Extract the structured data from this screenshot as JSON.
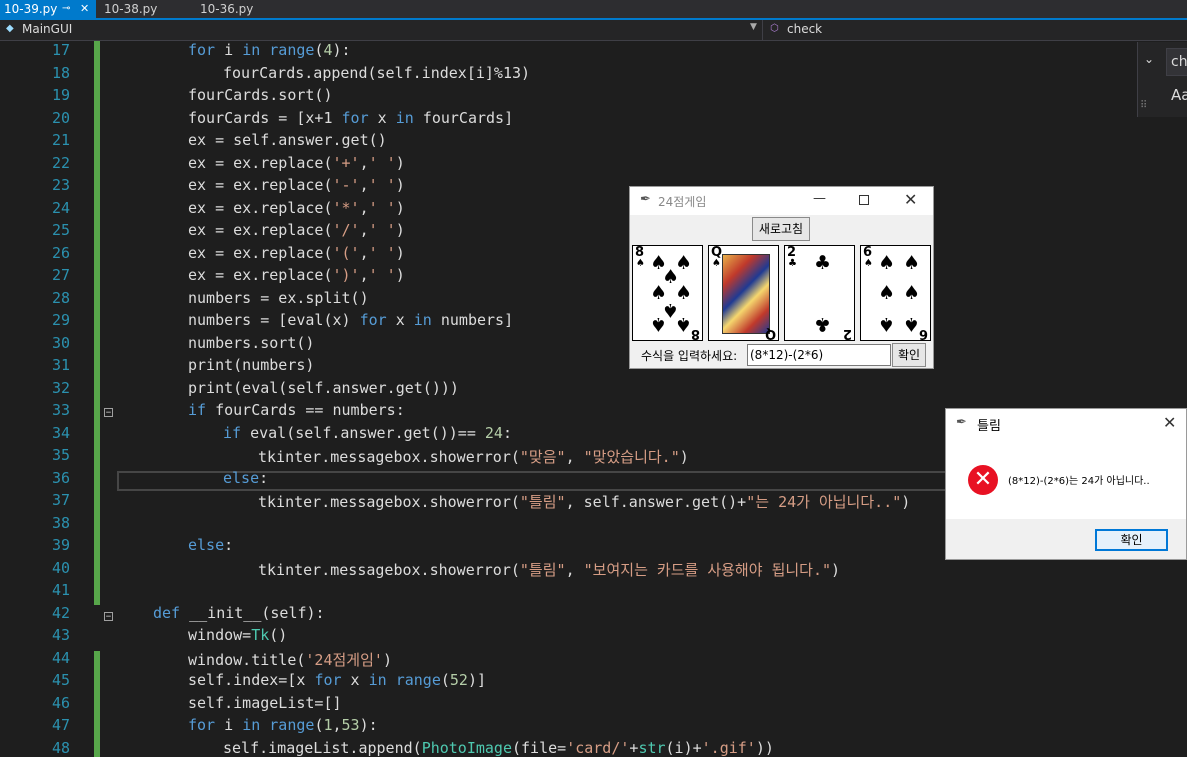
{
  "tabs": [
    {
      "label": "10-39.py",
      "active": true
    },
    {
      "label": "10-38.py",
      "active": false
    },
    {
      "label": "10-36.py",
      "active": false
    }
  ],
  "navbar": {
    "left_scope": "MainGUI",
    "right_member": "check"
  },
  "find_widget": {
    "search_text": "ch",
    "match_case_label": "Aa"
  },
  "editor": {
    "line_numbers": [
      "17",
      "18",
      "19",
      "20",
      "21",
      "22",
      "23",
      "24",
      "25",
      "26",
      "27",
      "28",
      "29",
      "30",
      "31",
      "32",
      "33",
      "34",
      "35",
      "36",
      "37",
      "38",
      "39",
      "40",
      "41",
      "42",
      "43",
      "44",
      "45",
      "46",
      "47",
      "48"
    ],
    "current_line": "36"
  },
  "tk_window": {
    "title": "24점게임",
    "refresh_label": "새로고침",
    "cards": [
      {
        "rank": "8",
        "suit": "spade",
        "glyph": "♠"
      },
      {
        "rank": "Q",
        "suit": "spade",
        "glyph": "♠"
      },
      {
        "rank": "2",
        "suit": "club",
        "glyph": "♣"
      },
      {
        "rank": "6",
        "suit": "spade",
        "glyph": "♠"
      }
    ],
    "expression_label": "수식을 입력하세요:",
    "expression_value": "(8*12)-(2*6)",
    "confirm_label": "확인"
  },
  "message_box": {
    "title": "틀림",
    "message": "(8*12)-(2*6)는 24가 아닙니다..",
    "ok_label": "확인",
    "icon": "error-icon"
  },
  "colors": {
    "accent": "#007acc",
    "keyword": "#569cd6",
    "string": "#d69d85",
    "number": "#b5cea8",
    "class": "#4ec9b0",
    "line_number": "#2b91af",
    "change_bar": "#57a64a"
  }
}
